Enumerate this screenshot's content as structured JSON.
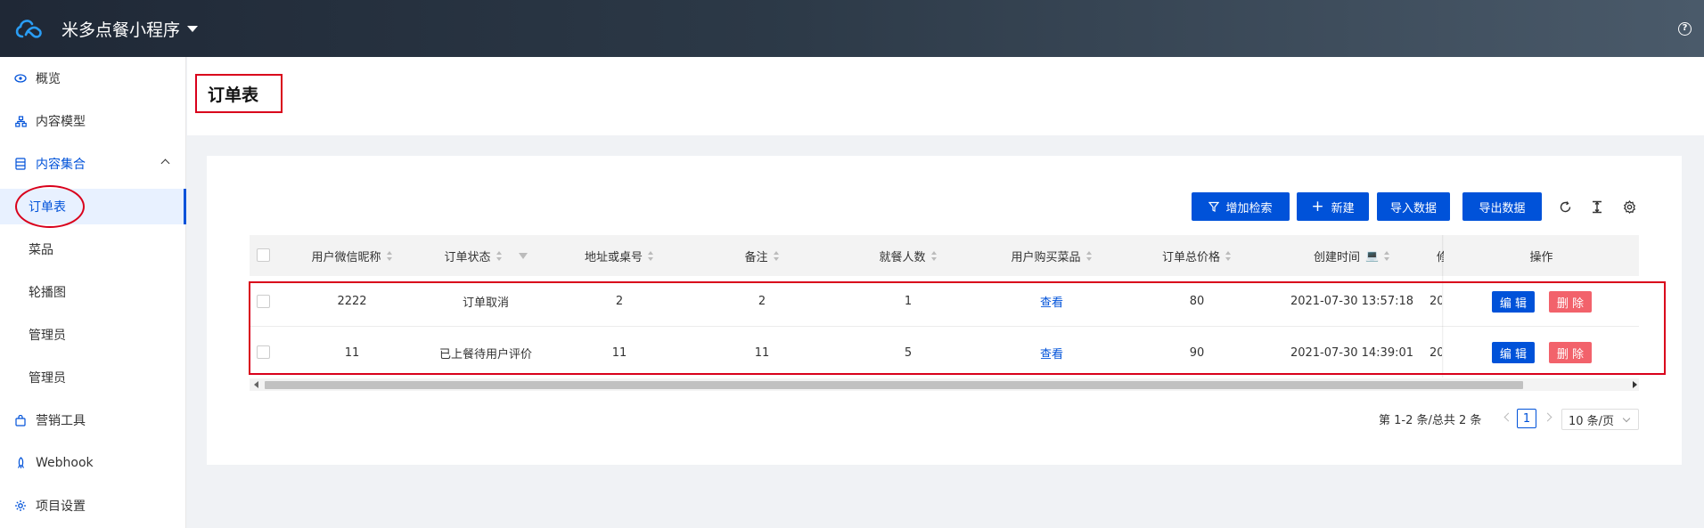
{
  "header": {
    "app_name": "米多点餐小程序",
    "help": "?"
  },
  "sidebar": {
    "overview": "概览",
    "content_model": "内容模型",
    "content_collection": "内容集合",
    "collections": [
      "订单表",
      "菜品",
      "轮播图",
      "管理员",
      "管理员"
    ],
    "marketing": "营销工具",
    "webhook": "Webhook",
    "settings": "项目设置"
  },
  "page": {
    "title": "订单表"
  },
  "toolbar": {
    "add_search": "增加检索",
    "new": "新建",
    "import": "导入数据",
    "export": "导出数据"
  },
  "table": {
    "columns": [
      "用户微信昵称",
      "订单状态",
      "地址或桌号",
      "备注",
      "就餐人数",
      "用户购买菜品",
      "订单总价格",
      "创建时间",
      "操作"
    ],
    "overflow_col_head": "修",
    "rows": [
      {
        "nickname": "2222",
        "status": "订单取消",
        "address": "2",
        "remark": "2",
        "diners": "1",
        "dishes": "查看",
        "total": "80",
        "created": "2021-07-30 13:57:18",
        "overflow": "20"
      },
      {
        "nickname": "11",
        "status": "已上餐待用户评价",
        "address": "11",
        "remark": "11",
        "diners": "5",
        "dishes": "查看",
        "total": "90",
        "created": "2021-07-30 14:39:01",
        "overflow": "20"
      }
    ],
    "edit_label": "编 辑",
    "delete_label": "删 除"
  },
  "pagination": {
    "summary": "第 1-2 条/总共 2 条",
    "current": "1",
    "page_size": "10 条/页"
  },
  "colors": {
    "primary": "#0052d9",
    "danger": "#f2626b",
    "annotation": "#d9001b"
  }
}
